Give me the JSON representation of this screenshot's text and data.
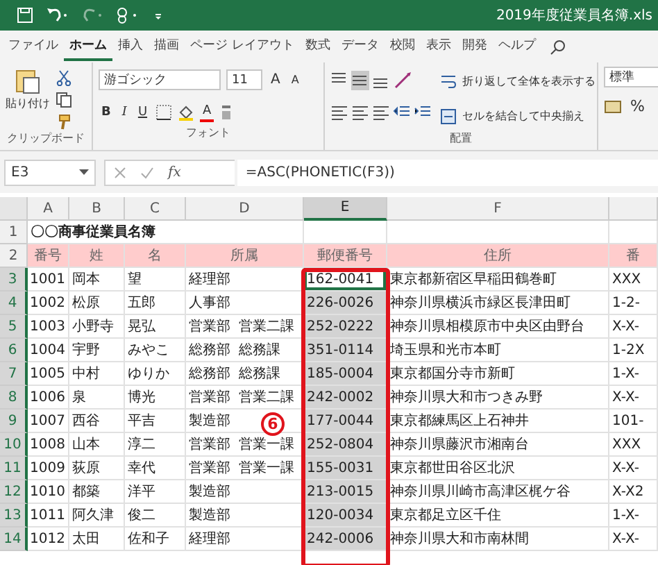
{
  "title_bar": {
    "title": "2019年度従業員名簿.xls"
  },
  "ribbon_tabs": [
    {
      "label": "ファイル",
      "selected": false
    },
    {
      "label": "ホーム",
      "selected": true
    },
    {
      "label": "挿入",
      "selected": false
    },
    {
      "label": "描画",
      "selected": false
    },
    {
      "label": "ページ レイアウト",
      "selected": false
    },
    {
      "label": "数式",
      "selected": false
    },
    {
      "label": "データ",
      "selected": false
    },
    {
      "label": "校閲",
      "selected": false
    },
    {
      "label": "表示",
      "selected": false
    },
    {
      "label": "開発",
      "selected": false
    },
    {
      "label": "ヘルプ",
      "selected": false
    }
  ],
  "ribbon": {
    "clipboard": {
      "paste_label": "貼り付け",
      "group_label": "クリップボード"
    },
    "font": {
      "font_name": "游ゴシック",
      "font_size": "11",
      "size_steps": [
        "A",
        "A"
      ],
      "styles": [
        {
          "label": "B",
          "kind": "bold"
        },
        {
          "label": "I",
          "kind": "italic"
        },
        {
          "label": "U",
          "kind": "underline"
        }
      ],
      "font_color_label": "A",
      "group_label": "フォント"
    },
    "alignment": {
      "vertical": [
        {
          "selected": false
        },
        {
          "selected": true
        },
        {
          "selected": false
        }
      ],
      "wrap_text": "折り返して全体を表示する",
      "merge_center": "セルを結合して中央揃え",
      "group_label": "配置"
    },
    "number": {
      "format": "標準",
      "percent": "%"
    }
  },
  "formula_bar": {
    "name_box": "E3",
    "fx": "fx",
    "formula": "=ASC(PHONETIC(F3))"
  },
  "sheet": {
    "columns": [
      {
        "label": "A",
        "selected": false
      },
      {
        "label": "B",
        "selected": false
      },
      {
        "label": "C",
        "selected": false
      },
      {
        "label": "D",
        "selected": false
      },
      {
        "label": "E",
        "selected": true
      },
      {
        "label": "F",
        "selected": false
      }
    ],
    "rows": [
      {
        "number": "1",
        "kind": "title",
        "selected": false,
        "active": false,
        "cells": [
          "〇〇商事従業員名簿"
        ]
      },
      {
        "number": "2",
        "kind": "header",
        "selected": false,
        "active": false,
        "cells": [
          "番号",
          "姓",
          "名",
          [
            "所属"
          ],
          "郵便番号",
          "住所",
          "番"
        ]
      },
      {
        "number": "3",
        "kind": "data",
        "selected": true,
        "active": true,
        "cells": [
          "1001",
          "岡本",
          "望",
          [
            "経理部"
          ],
          "162-0041",
          "東京都新宿区早稲田鶴巻町",
          "XXX"
        ]
      },
      {
        "number": "4",
        "kind": "data",
        "selected": true,
        "active": false,
        "cells": [
          "1002",
          "松原",
          "五郎",
          [
            "人事部"
          ],
          "226-0026",
          "神奈川県横浜市緑区長津田町",
          "1-2-"
        ]
      },
      {
        "number": "5",
        "kind": "data",
        "selected": true,
        "active": false,
        "cells": [
          "1003",
          "小野寺",
          "晃弘",
          [
            "営業部",
            "営業二課"
          ],
          "252-0222",
          "神奈川県相模原市中央区由野台",
          "X-X-"
        ]
      },
      {
        "number": "6",
        "kind": "data",
        "selected": true,
        "active": false,
        "cells": [
          "1004",
          "宇野",
          "みやこ",
          [
            "総務部",
            "総務課"
          ],
          "351-0114",
          "埼玉県和光市本町",
          "1-2X"
        ]
      },
      {
        "number": "7",
        "kind": "data",
        "selected": true,
        "active": false,
        "cells": [
          "1005",
          "中村",
          "ゆりか",
          [
            "総務部",
            "総務課"
          ],
          "185-0004",
          "東京都国分寺市新町",
          "1-X-"
        ]
      },
      {
        "number": "8",
        "kind": "data",
        "selected": true,
        "active": false,
        "cells": [
          "1006",
          "泉",
          "博光",
          [
            "営業部",
            "営業二課"
          ],
          "242-0002",
          "神奈川県大和市つきみ野",
          "X-X-"
        ]
      },
      {
        "number": "9",
        "kind": "data",
        "selected": true,
        "active": false,
        "cells": [
          "1007",
          "西谷",
          "平吉",
          [
            "製造部"
          ],
          "177-0044",
          "東京都練馬区上石神井",
          "101-"
        ]
      },
      {
        "number": "10",
        "kind": "data",
        "selected": true,
        "active": false,
        "cells": [
          "1008",
          "山本",
          "淳二",
          [
            "営業部",
            "営業一課"
          ],
          "252-0804",
          "神奈川県藤沢市湘南台",
          "XXX"
        ]
      },
      {
        "number": "11",
        "kind": "data",
        "selected": true,
        "active": false,
        "cells": [
          "1009",
          "荻原",
          "幸代",
          [
            "営業部",
            "営業一課"
          ],
          "155-0031",
          "東京都世田谷区北沢",
          "X-X-"
        ]
      },
      {
        "number": "12",
        "kind": "data",
        "selected": true,
        "active": false,
        "cells": [
          "1010",
          "都築",
          "洋平",
          [
            "製造部"
          ],
          "213-0015",
          "神奈川県川崎市高津区梶ケ谷",
          "X-X2"
        ]
      },
      {
        "number": "13",
        "kind": "data",
        "selected": true,
        "active": false,
        "cells": [
          "1011",
          "阿久津",
          "俊二",
          [
            "製造部"
          ],
          "120-0034",
          "東京都足立区千住",
          "1-X-"
        ]
      },
      {
        "number": "14",
        "kind": "data",
        "selected": true,
        "active": false,
        "cells": [
          "1012",
          "太田",
          "佐和子",
          [
            "経理部"
          ],
          "242-0006",
          "神奈川県大和市南林間",
          "X-X-"
        ]
      }
    ],
    "callout": {
      "label": "6"
    }
  }
}
